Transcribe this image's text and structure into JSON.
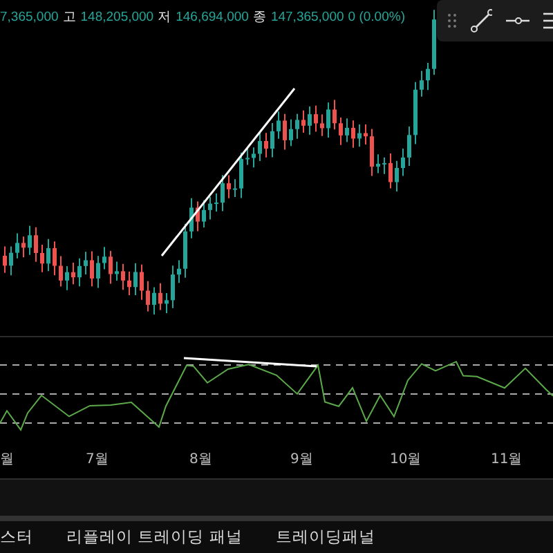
{
  "header": {
    "first_value": "7,365,000",
    "items": [
      {
        "label": "고",
        "value": "148,205,000"
      },
      {
        "label": "저",
        "value": "146,694,000"
      },
      {
        "label": "종",
        "value": "147,365,000"
      }
    ],
    "change": "0 (0.00%)"
  },
  "x_axis": {
    "labels": [
      "월",
      "7월",
      "8월",
      "9월",
      "10월",
      "11월"
    ]
  },
  "bottom_tabs": [
    {
      "label": "스터"
    },
    {
      "label": "리플레이 트레이딩 패널"
    },
    {
      "label": "트레이딩패널"
    }
  ]
}
